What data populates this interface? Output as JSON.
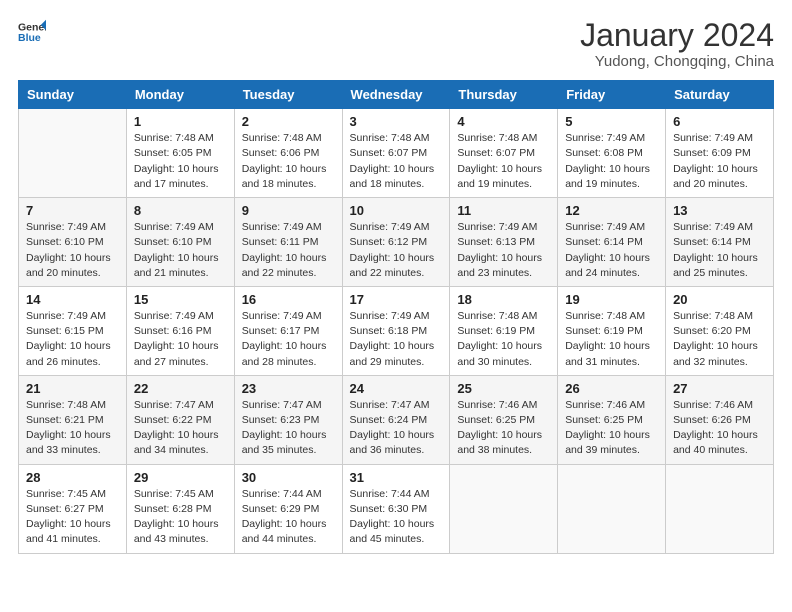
{
  "logo": {
    "line1": "General",
    "line2": "Blue"
  },
  "title": "January 2024",
  "subtitle": "Yudong, Chongqing, China",
  "days_of_week": [
    "Sunday",
    "Monday",
    "Tuesday",
    "Wednesday",
    "Thursday",
    "Friday",
    "Saturday"
  ],
  "weeks": [
    [
      {
        "day": "",
        "info": ""
      },
      {
        "day": "1",
        "info": "Sunrise: 7:48 AM\nSunset: 6:05 PM\nDaylight: 10 hours\nand 17 minutes."
      },
      {
        "day": "2",
        "info": "Sunrise: 7:48 AM\nSunset: 6:06 PM\nDaylight: 10 hours\nand 18 minutes."
      },
      {
        "day": "3",
        "info": "Sunrise: 7:48 AM\nSunset: 6:07 PM\nDaylight: 10 hours\nand 18 minutes."
      },
      {
        "day": "4",
        "info": "Sunrise: 7:48 AM\nSunset: 6:07 PM\nDaylight: 10 hours\nand 19 minutes."
      },
      {
        "day": "5",
        "info": "Sunrise: 7:49 AM\nSunset: 6:08 PM\nDaylight: 10 hours\nand 19 minutes."
      },
      {
        "day": "6",
        "info": "Sunrise: 7:49 AM\nSunset: 6:09 PM\nDaylight: 10 hours\nand 20 minutes."
      }
    ],
    [
      {
        "day": "7",
        "info": "Sunrise: 7:49 AM\nSunset: 6:10 PM\nDaylight: 10 hours\nand 20 minutes."
      },
      {
        "day": "8",
        "info": "Sunrise: 7:49 AM\nSunset: 6:10 PM\nDaylight: 10 hours\nand 21 minutes."
      },
      {
        "day": "9",
        "info": "Sunrise: 7:49 AM\nSunset: 6:11 PM\nDaylight: 10 hours\nand 22 minutes."
      },
      {
        "day": "10",
        "info": "Sunrise: 7:49 AM\nSunset: 6:12 PM\nDaylight: 10 hours\nand 22 minutes."
      },
      {
        "day": "11",
        "info": "Sunrise: 7:49 AM\nSunset: 6:13 PM\nDaylight: 10 hours\nand 23 minutes."
      },
      {
        "day": "12",
        "info": "Sunrise: 7:49 AM\nSunset: 6:14 PM\nDaylight: 10 hours\nand 24 minutes."
      },
      {
        "day": "13",
        "info": "Sunrise: 7:49 AM\nSunset: 6:14 PM\nDaylight: 10 hours\nand 25 minutes."
      }
    ],
    [
      {
        "day": "14",
        "info": "Sunrise: 7:49 AM\nSunset: 6:15 PM\nDaylight: 10 hours\nand 26 minutes."
      },
      {
        "day": "15",
        "info": "Sunrise: 7:49 AM\nSunset: 6:16 PM\nDaylight: 10 hours\nand 27 minutes."
      },
      {
        "day": "16",
        "info": "Sunrise: 7:49 AM\nSunset: 6:17 PM\nDaylight: 10 hours\nand 28 minutes."
      },
      {
        "day": "17",
        "info": "Sunrise: 7:49 AM\nSunset: 6:18 PM\nDaylight: 10 hours\nand 29 minutes."
      },
      {
        "day": "18",
        "info": "Sunrise: 7:48 AM\nSunset: 6:19 PM\nDaylight: 10 hours\nand 30 minutes."
      },
      {
        "day": "19",
        "info": "Sunrise: 7:48 AM\nSunset: 6:19 PM\nDaylight: 10 hours\nand 31 minutes."
      },
      {
        "day": "20",
        "info": "Sunrise: 7:48 AM\nSunset: 6:20 PM\nDaylight: 10 hours\nand 32 minutes."
      }
    ],
    [
      {
        "day": "21",
        "info": "Sunrise: 7:48 AM\nSunset: 6:21 PM\nDaylight: 10 hours\nand 33 minutes."
      },
      {
        "day": "22",
        "info": "Sunrise: 7:47 AM\nSunset: 6:22 PM\nDaylight: 10 hours\nand 34 minutes."
      },
      {
        "day": "23",
        "info": "Sunrise: 7:47 AM\nSunset: 6:23 PM\nDaylight: 10 hours\nand 35 minutes."
      },
      {
        "day": "24",
        "info": "Sunrise: 7:47 AM\nSunset: 6:24 PM\nDaylight: 10 hours\nand 36 minutes."
      },
      {
        "day": "25",
        "info": "Sunrise: 7:46 AM\nSunset: 6:25 PM\nDaylight: 10 hours\nand 38 minutes."
      },
      {
        "day": "26",
        "info": "Sunrise: 7:46 AM\nSunset: 6:25 PM\nDaylight: 10 hours\nand 39 minutes."
      },
      {
        "day": "27",
        "info": "Sunrise: 7:46 AM\nSunset: 6:26 PM\nDaylight: 10 hours\nand 40 minutes."
      }
    ],
    [
      {
        "day": "28",
        "info": "Sunrise: 7:45 AM\nSunset: 6:27 PM\nDaylight: 10 hours\nand 41 minutes."
      },
      {
        "day": "29",
        "info": "Sunrise: 7:45 AM\nSunset: 6:28 PM\nDaylight: 10 hours\nand 43 minutes."
      },
      {
        "day": "30",
        "info": "Sunrise: 7:44 AM\nSunset: 6:29 PM\nDaylight: 10 hours\nand 44 minutes."
      },
      {
        "day": "31",
        "info": "Sunrise: 7:44 AM\nSunset: 6:30 PM\nDaylight: 10 hours\nand 45 minutes."
      },
      {
        "day": "",
        "info": ""
      },
      {
        "day": "",
        "info": ""
      },
      {
        "day": "",
        "info": ""
      }
    ]
  ]
}
